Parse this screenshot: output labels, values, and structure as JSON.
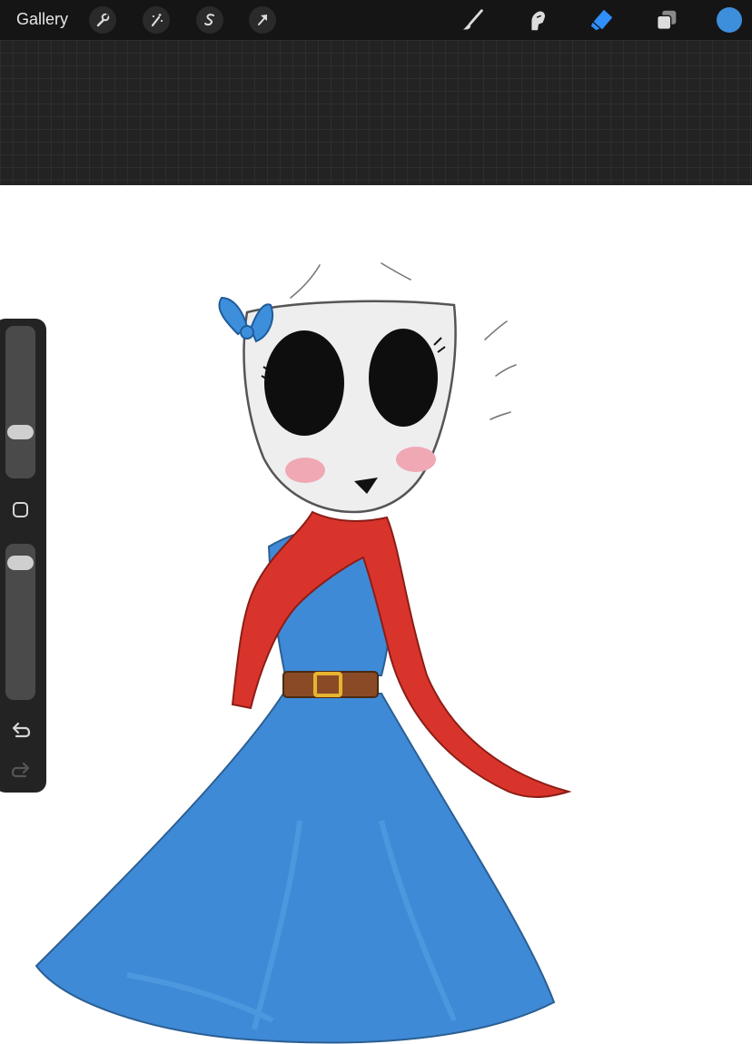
{
  "toolbar": {
    "gallery_label": "Gallery",
    "left_tools": [
      {
        "name": "actions",
        "icon": "wrench-icon"
      },
      {
        "name": "adjustments",
        "icon": "magic-wand-icon"
      },
      {
        "name": "selection",
        "icon": "selection-s-icon"
      },
      {
        "name": "transform",
        "icon": "arrow-cursor-icon"
      }
    ],
    "right_tools": [
      {
        "name": "brush",
        "icon": "brush-icon",
        "active": false
      },
      {
        "name": "smudge",
        "icon": "smudge-finger-icon",
        "active": false
      },
      {
        "name": "eraser",
        "icon": "eraser-icon",
        "active": true
      },
      {
        "name": "layers",
        "icon": "layers-icon",
        "active": false
      }
    ],
    "current_color": "#3d8fdc",
    "active_color": "#2f8fff"
  },
  "sidebar": {
    "brush_size_level": 0.28,
    "opacity_level": 0.93,
    "modify_icon": "square-outline-icon",
    "undo_icon": "undo-arrow-icon",
    "redo_icon": "redo-arrow-icon",
    "redo_enabled": false
  },
  "canvas": {
    "background": "#ffffff",
    "colors": {
      "dress": "#3f8ad6",
      "scarf": "#d9342b",
      "mask": "#eeeeee",
      "bow": "#3d8fdc",
      "belt": "#8a4a26",
      "buckle": "#e6b430",
      "blush": "#f0a8b4"
    }
  }
}
